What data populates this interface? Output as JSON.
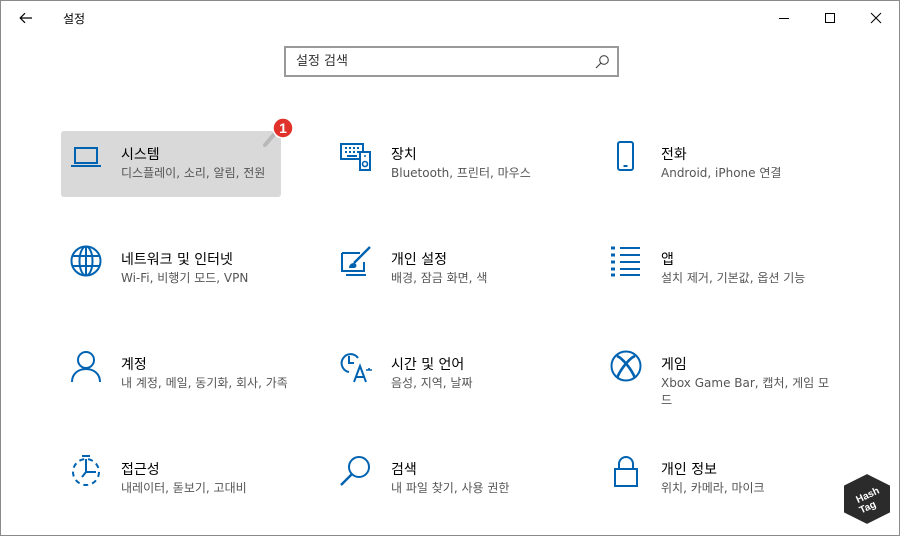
{
  "window": {
    "title": "설정"
  },
  "search": {
    "placeholder": "설정 검색"
  },
  "tiles": [
    {
      "title": "시스템",
      "desc": "디스플레이, 소리, 알림, 전원",
      "icon": "laptop-icon"
    },
    {
      "title": "장치",
      "desc": "Bluetooth, 프린터, 마우스",
      "icon": "keyboard-speaker-icon"
    },
    {
      "title": "전화",
      "desc": "Android, iPhone 연결",
      "icon": "phone-icon"
    },
    {
      "title": "네트워크 및 인터넷",
      "desc": "Wi-Fi, 비행기 모드, VPN",
      "icon": "globe-icon"
    },
    {
      "title": "개인 설정",
      "desc": "배경, 잠금 화면, 색",
      "icon": "paintbrush-icon"
    },
    {
      "title": "앱",
      "desc": "설치 제거, 기본값, 옵션 기능",
      "icon": "apps-list-icon"
    },
    {
      "title": "계정",
      "desc": "내 계정, 메일, 동기화, 회사, 가족",
      "icon": "person-icon"
    },
    {
      "title": "시간 및 언어",
      "desc": "음성, 지역, 날짜",
      "icon": "time-language-icon"
    },
    {
      "title": "게임",
      "desc": "Xbox Game Bar, 캡처, 게임 모드",
      "icon": "xbox-icon"
    },
    {
      "title": "접근성",
      "desc": "내레이터, 돋보기, 고대비",
      "icon": "ease-of-access-icon"
    },
    {
      "title": "검색",
      "desc": "내 파일 찾기, 사용 권한",
      "icon": "search-magnifier-icon"
    },
    {
      "title": "개인 정보",
      "desc": "위치, 카메라, 마이크",
      "icon": "lock-icon"
    }
  ],
  "badge": {
    "number": "1",
    "color": "#e0312b"
  },
  "watermark": {
    "line1": "Hash",
    "line2": "Tag"
  },
  "accent": "#0063b1"
}
